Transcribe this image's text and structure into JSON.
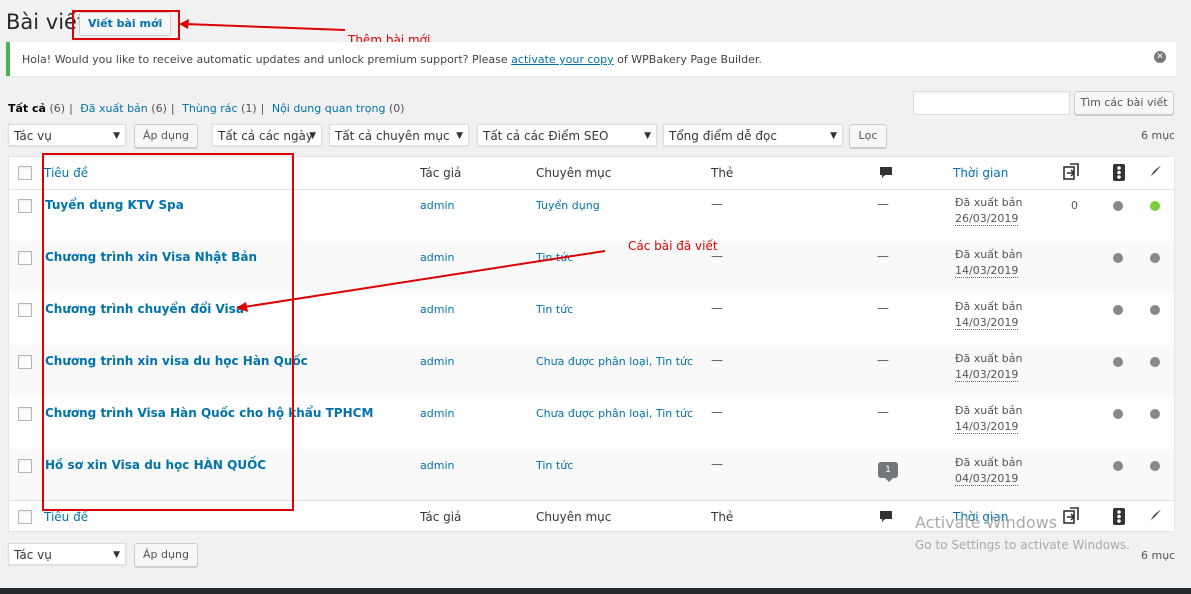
{
  "header": {
    "page_title": "Bài viết",
    "add_new_label": "Viết bài mới"
  },
  "notice": {
    "text_before": "Hola! Would you like to receive automatic updates and unlock premium support? Please ",
    "link_text": "activate your copy",
    "text_after": " of WPBakery Page Builder.",
    "dismiss_glyph": "✕"
  },
  "filters": {
    "all": "Tất cả",
    "all_count": "(6)",
    "published": "Đã xuất bản",
    "published_count": "(6)",
    "trash": "Thùng rác",
    "trash_count": "(1)",
    "cornerstone": "Nội dung quan trọng",
    "cornerstone_count": "(0)"
  },
  "search": {
    "placeholder": "",
    "button_label": "Tìm các bài viết"
  },
  "tablenav_top": {
    "bulk_action": "Tác vụ",
    "apply_label": "Áp dụng",
    "dates": "Tất cả các ngày",
    "categories": "Tất cả chuyên mục",
    "seo": "Tất cả các Điểm SEO",
    "readability": "Tổng điểm dễ đọc",
    "filter_label": "Lọc",
    "items_count": "6 mục"
  },
  "columns": {
    "title": "Tiêu đề",
    "author": "Tác giả",
    "categories": "Chuyên mục",
    "tags": "Thẻ",
    "date": "Thời gian"
  },
  "rows": [
    {
      "title": "Tuyển dụng KTV Spa",
      "author": "admin",
      "categories": "Tuyển dụng",
      "tags": "—",
      "comments": "—",
      "status": "Đã xuất bản",
      "date": "26/03/2019",
      "links": "0",
      "seo": "grey",
      "readability": "green"
    },
    {
      "title": "Chương trình xin Visa Nhật Bản",
      "author": "admin",
      "categories": "Tin tức",
      "tags": "—",
      "comments": "—",
      "status": "Đã xuất bản",
      "date": "14/03/2019",
      "links": "",
      "seo": "grey",
      "readability": "grey"
    },
    {
      "title": "Chương trình chuyển đổi Visa",
      "author": "admin",
      "categories": "Tin tức",
      "tags": "—",
      "comments": "—",
      "status": "Đã xuất bản",
      "date": "14/03/2019",
      "links": "",
      "seo": "grey",
      "readability": "grey"
    },
    {
      "title": "Chương trình xin visa du học Hàn Quốc",
      "author": "admin",
      "categories": "Chưa được phân loại, Tin tức",
      "tags": "—",
      "comments": "—",
      "status": "Đã xuất bản",
      "date": "14/03/2019",
      "links": "",
      "seo": "grey",
      "readability": "grey"
    },
    {
      "title": "Chương trình Visa Hàn Quốc cho hộ khẩu TPHCM",
      "author": "admin",
      "categories": "Chưa được phân loại, Tin tức",
      "tags": "—",
      "comments": "—",
      "status": "Đã xuất bản",
      "date": "14/03/2019",
      "links": "",
      "seo": "grey",
      "readability": "grey"
    },
    {
      "title": "Hồ sơ xin Visa du học HÀN QUỐC",
      "author": "admin",
      "categories": "Tin tức",
      "tags": "—",
      "comments": "1",
      "status": "Đã xuất bản",
      "date": "04/03/2019",
      "links": "",
      "seo": "grey",
      "readability": "grey"
    }
  ],
  "tablenav_bottom": {
    "bulk_action": "Tác vụ",
    "apply_label": "Áp dụng",
    "items_count": "6 mục"
  },
  "annotations": {
    "add_new_note": "Thêm bài mới",
    "posts_note": "Các bài đã viết"
  },
  "watermark": {
    "line1": "Activate Windows",
    "line2": "Go to Settings to activate Windows."
  },
  "colors": {
    "accent": "#0073aa",
    "annotation": "#dd0000",
    "notice_border": "#46b450",
    "good": "#7ad03a"
  },
  "icons": {
    "comments_header": "comment-bubble-icon",
    "links_header": "internal-links-icon",
    "seo_header": "seo-traffic-light-icon",
    "readability_header": "readability-quill-icon"
  }
}
